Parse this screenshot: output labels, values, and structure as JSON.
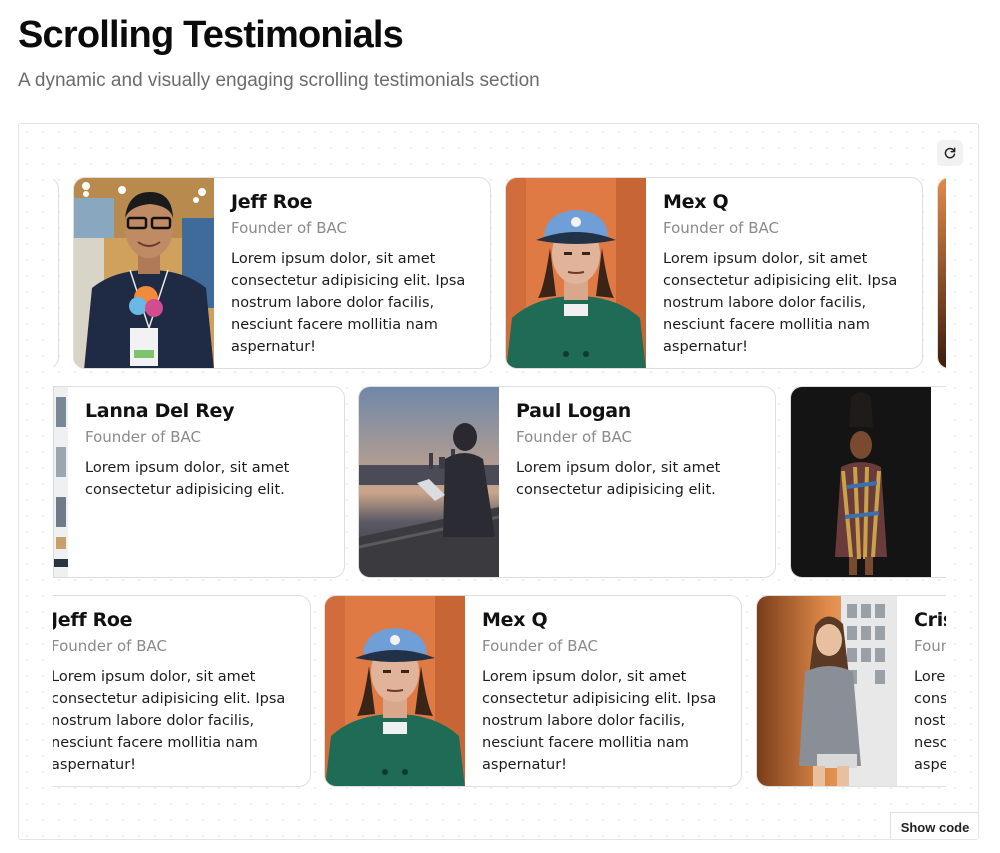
{
  "header": {
    "title": "Scrolling Testimonials",
    "subtitle": "A dynamic and visually engaging scrolling testimonials section"
  },
  "toolbar": {
    "reload_icon": "refresh-icon",
    "show_code_label": "Show code"
  },
  "rows": [
    {
      "cards": [
        {
          "name": "Jeff Roe",
          "role": "Founder of BAC",
          "quote": "Lorem ipsum dolor, sit amet consectetur adipisicing elit. Ipsa nostrum labore dolor facilis, nesciunt facere mollitia nam aspernatur!",
          "photo": "man-with-glasses-photo"
        },
        {
          "name": "Mex Q",
          "role": "Founder of BAC",
          "quote": "Lorem ipsum dolor, sit amet consectetur adipisicing elit. Ipsa nostrum labore dolor facilis, nesciunt facere mollitia nam aspernatur!",
          "photo": "man-in-blue-cap-photo"
        }
      ]
    },
    {
      "cards": [
        {
          "name": "Lanna Del Rey",
          "role": "Founder of BAC",
          "quote": "Lorem ipsum dolor, sit amet consectetur adipisicing elit.",
          "photo": "office-window-photo"
        },
        {
          "name": "Paul Logan",
          "role": "Founder of BAC",
          "quote": "Lorem ipsum dolor, sit amet consectetur adipisicing elit.",
          "photo": "man-with-laptop-city-photo"
        }
      ]
    },
    {
      "cards": [
        {
          "name": "Jeff Roe",
          "role": "Founder of BAC",
          "quote": "Lorem ipsum dolor, sit amet consectetur adipisicing elit. Ipsa nostrum labore dolor facilis, nesciunt facere mollitia nam aspernatur!",
          "photo": "none"
        },
        {
          "name": "Mex Q",
          "role": "Founder of BAC",
          "quote": "Lorem ipsum dolor, sit amet consectetur adipisicing elit. Ipsa nostrum labore dolor facilis, nesciunt facere mollitia nam aspernatur!",
          "photo": "man-in-blue-cap-photo"
        },
        {
          "name": "Cris",
          "role": "Founder of BAC",
          "quote": "Lorem ipsum dolor, sit amet consectetur adipisicing elit. Ipsa nostrum labore dolor facilis, nesciunt facere mollitia nam aspernatur!",
          "photo": "woman-in-blazer-photo"
        }
      ]
    }
  ],
  "colors": {
    "card_border": "#dedede",
    "muted_text": "#8a8a8a",
    "orange_wall": "#e07a45",
    "jacket_green": "#1f6b55",
    "cap_blue": "#6f9fd6"
  }
}
